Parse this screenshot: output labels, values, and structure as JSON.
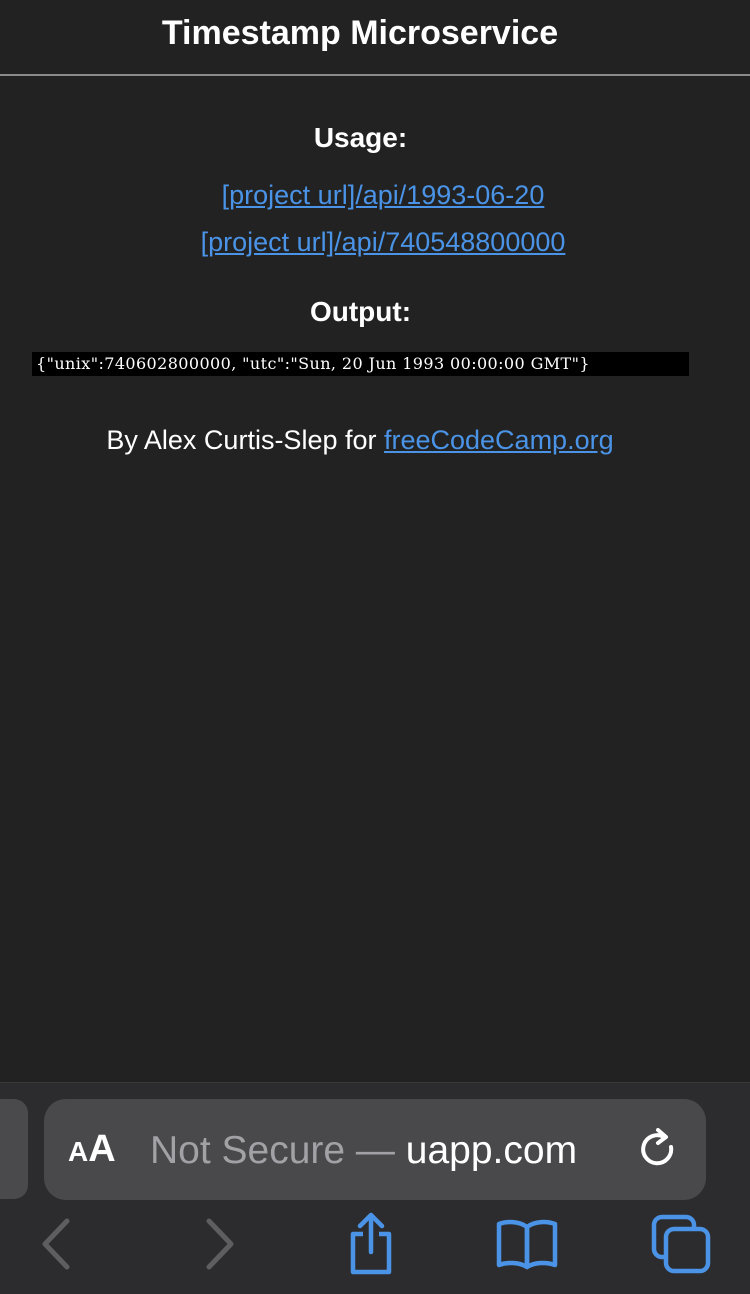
{
  "header": {
    "title": "Timestamp Microservice"
  },
  "usage": {
    "heading": "Usage:",
    "links": [
      "[project url]/api/1993-06-20",
      "[project url]/api/740548800000"
    ]
  },
  "output": {
    "heading": "Output:",
    "example": "{\"unix\":740602800000, \"utc\":\"Sun, 20 Jun 1993 00:00:00 GMT\"}"
  },
  "credit": {
    "prefix": "By Alex Curtis-Slep for ",
    "link_text": "freeCodeCamp.org"
  },
  "browser": {
    "text_size_label_small": "A",
    "text_size_label_large": "A",
    "address_prefix": "Not Secure — ",
    "address_host": "uapp.com",
    "icons": {
      "reload": "reload-icon",
      "back": "chevron-left-icon",
      "forward": "chevron-right-icon",
      "share": "share-icon",
      "bookmarks": "book-icon",
      "tabs": "tabs-icon"
    },
    "colors": {
      "accent": "#4a93e6",
      "disabled": "#5e5e60",
      "toolbar_bg": "#2c2c2e"
    }
  }
}
